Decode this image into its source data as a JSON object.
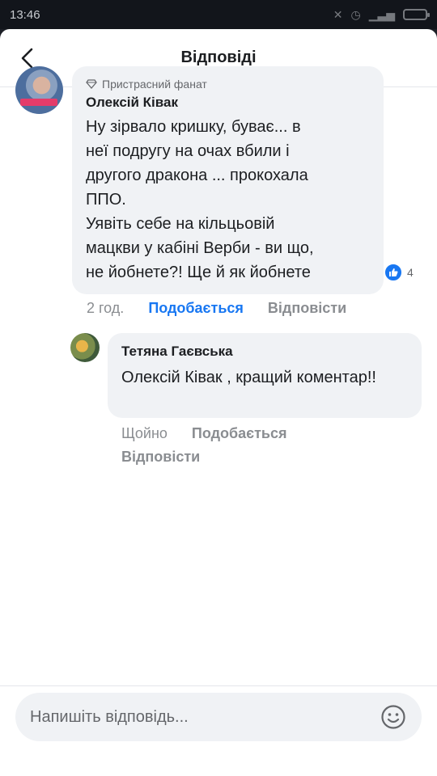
{
  "status_bar": {
    "time": "13:46"
  },
  "header": {
    "title": "Відповіді"
  },
  "comment": {
    "badge": "Пристрасний фанат",
    "author": "Олексій Ківак",
    "text": "Ну зірвало кришку, буває... в\nнеї подругу на очах вбили і\nдругого дракона ... прокохала\nППО.\nУявіть себе на кільцьовій\nмацкви у кабіні Верби - ви що,\nне йобнете?! Ще й як йобнете",
    "reaction_count": "4",
    "time": "2 год.",
    "like_label": "Подобається",
    "reply_label": "Відповісти"
  },
  "reply": {
    "author": "Тетяна Гаєвська",
    "text": "Олексій Ківак  , кращий коментар!!",
    "time": "Щойно",
    "like_label": "Подобається",
    "reply_label": "Відповісти"
  },
  "composer": {
    "placeholder": "Напишіть відповідь..."
  },
  "colors": {
    "accent": "#1877f2",
    "bubble": "#f0f2f5",
    "meta": "#8a8d91"
  }
}
